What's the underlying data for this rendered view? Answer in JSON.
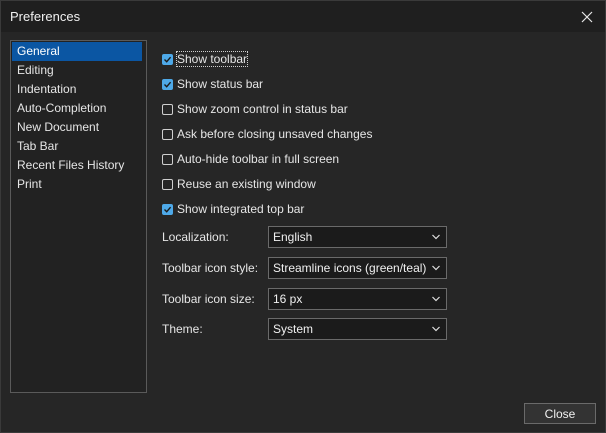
{
  "window": {
    "title": "Preferences"
  },
  "sidebar": {
    "items": [
      {
        "label": "General",
        "selected": true
      },
      {
        "label": "Editing",
        "selected": false
      },
      {
        "label": "Indentation",
        "selected": false
      },
      {
        "label": "Auto-Completion",
        "selected": false
      },
      {
        "label": "New Document",
        "selected": false
      },
      {
        "label": "Tab Bar",
        "selected": false
      },
      {
        "label": "Recent Files History",
        "selected": false
      },
      {
        "label": "Print",
        "selected": false
      }
    ]
  },
  "general": {
    "checkboxes": [
      {
        "label": "Show toolbar",
        "checked": true
      },
      {
        "label": "Show status bar",
        "checked": true
      },
      {
        "label": "Show zoom control in status bar",
        "checked": false
      },
      {
        "label": "Ask before closing unsaved changes",
        "checked": false
      },
      {
        "label": "Auto-hide toolbar in full screen",
        "checked": false
      },
      {
        "label": "Reuse an existing window",
        "checked": false
      },
      {
        "label": "Show integrated top bar",
        "checked": true
      }
    ],
    "fields": [
      {
        "label": "Localization:",
        "value": "English"
      },
      {
        "label": "Toolbar icon style:",
        "value": "Streamline icons (green/teal)"
      },
      {
        "label": "Toolbar icon size:",
        "value": "16 px"
      },
      {
        "label": "Theme:",
        "value": "System"
      }
    ]
  },
  "footer": {
    "close_label": "Close"
  },
  "colors": {
    "accent": "#0b56a3",
    "checkbox_checked": "#4ea9e8",
    "background": "#262626"
  }
}
